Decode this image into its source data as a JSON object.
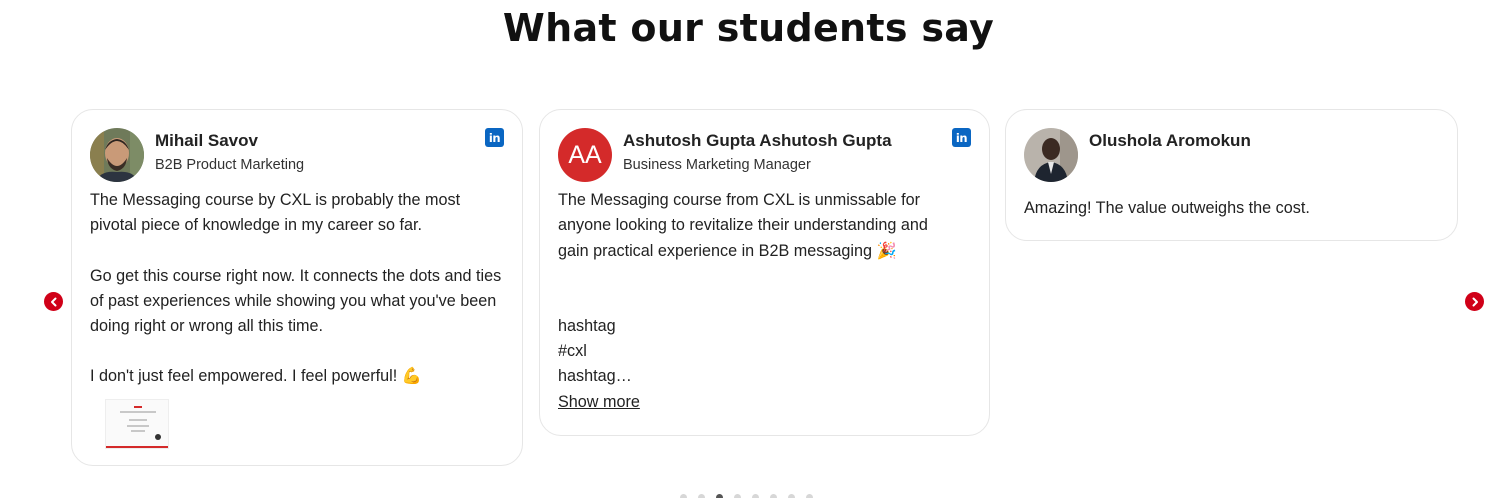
{
  "heading": "What our students say",
  "testimonials": [
    {
      "name": "Mihail Savov",
      "role": "B2B Product Marketing",
      "has_linkedin": true,
      "paragraphs": [
        "The Messaging course by CXL is probably the most pivotal piece of knowledge in my career so far.",
        "Go get this course right now. It connects the dots and ties of past experiences while showing you what you've been doing right or wrong all this time.",
        "I don't just feel empowered. I feel powerful! 💪"
      ],
      "attachment_icon": "certificate-thumbnail"
    },
    {
      "name": "Ashutosh Gupta Ashutosh Gupta",
      "initials": "AA",
      "role": "Business Marketing Manager",
      "has_linkedin": true,
      "paragraphs": [
        "The Messaging course from CXL is unmissable for anyone looking to revitalize their understanding and gain practical experience in B2B messaging 🎉"
      ],
      "hashtag_lines": [
        "hashtag",
        "#cxl",
        "hashtag…"
      ],
      "show_more": "Show more"
    },
    {
      "name": "Olushola Aromokun",
      "role": "",
      "has_linkedin": false,
      "paragraphs": [
        "Amazing! The value outweighs the cost."
      ]
    }
  ],
  "carousel": {
    "prev_icon": "chevron-left-icon",
    "next_icon": "chevron-right-icon",
    "dot_count": 8,
    "active_dot": 2
  },
  "colors": {
    "accent_red": "#d00018",
    "avatar_red": "#d42a2a",
    "linkedin_blue": "#0a66c2"
  }
}
